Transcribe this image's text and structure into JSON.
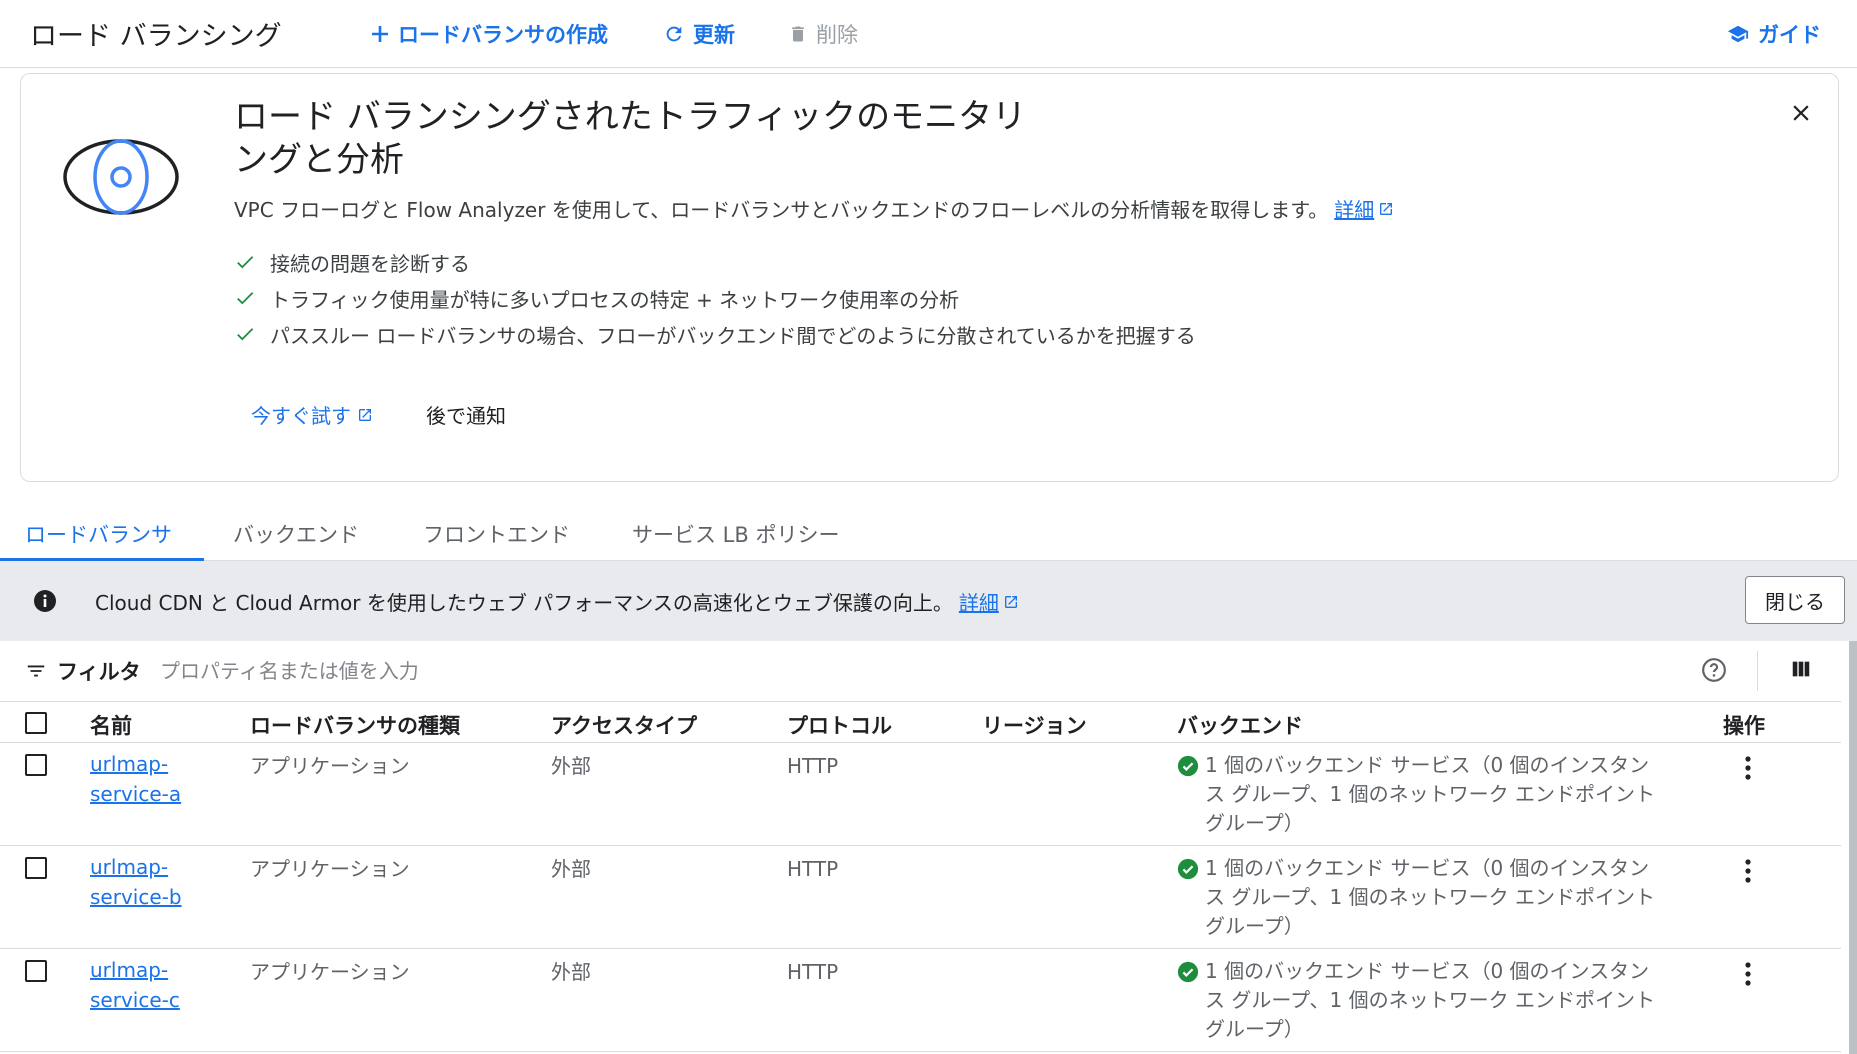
{
  "header": {
    "title": "ロード バランシング",
    "create_label": "ロードバランサの作成",
    "refresh_label": "更新",
    "delete_label": "削除",
    "guide_label": "ガイド"
  },
  "banner": {
    "title": "ロード バランシングされたトラフィックのモニタリングと分析",
    "description": "VPC フローログと Flow Analyzer を使用して、ロードバランサとバックエンドのフローレベルの分析情報を取得します。",
    "details_link": "詳細",
    "features": [
      "接続の問題を診断する",
      "トラフィック使用量が特に多いプロセスの特定 + ネットワーク使用率の分析",
      "パススルー ロードバランサの場合、フローがバックエンド間でどのように分散されているかを把握する"
    ],
    "try_now_label": "今すぐ試す",
    "remind_later_label": "後で通知"
  },
  "tabs": [
    {
      "label": "ロードバランサ",
      "active": true
    },
    {
      "label": "バックエンド",
      "active": false
    },
    {
      "label": "フロントエンド",
      "active": false
    },
    {
      "label": "サービス LB ポリシー",
      "active": false
    }
  ],
  "infobar": {
    "text": "Cloud CDN と Cloud Armor を使用したウェブ パフォーマンスの高速化とウェブ保護の向上。",
    "details_link": "詳細",
    "dismiss_label": "閉じる"
  },
  "filter": {
    "label": "フィルタ",
    "placeholder": "プロパティ名または値を入力"
  },
  "table": {
    "columns": [
      "名前",
      "ロードバランサの種類",
      "アクセスタイプ",
      "プロトコル",
      "リージョン",
      "バックエンド",
      "操作"
    ],
    "rows": [
      {
        "name": "urlmap-service-a",
        "type": "アプリケーション",
        "access": "外部",
        "protocol": "HTTP",
        "region": "",
        "backend": "1 個のバックエンド サービス（0 個のインスタンス グループ、1 個のネットワーク エンドポイント グループ）"
      },
      {
        "name": "urlmap-service-b",
        "type": "アプリケーション",
        "access": "外部",
        "protocol": "HTTP",
        "region": "",
        "backend": "1 個のバックエンド サービス（0 個のインスタンス グループ、1 個のネットワーク エンドポイント グループ）"
      },
      {
        "name": "urlmap-service-c",
        "type": "アプリケーション",
        "access": "外部",
        "protocol": "HTTP",
        "region": "",
        "backend": "1 個のバックエンド サービス（0 個のインスタンス グループ、1 個のネットワーク エンドポイント グループ）"
      }
    ]
  },
  "colors": {
    "accent": "#1a73e8",
    "success": "#1e8e3e",
    "infobar_bg": "#e8eaed",
    "border": "#dadce0"
  },
  "icons": {
    "create": "plus-icon",
    "refresh": "refresh-icon",
    "delete": "trash-icon",
    "guide": "graduation-cap-icon",
    "close": "close-icon",
    "info": "info-icon",
    "filter": "filter-icon",
    "help": "help-icon",
    "columns": "columns-icon",
    "more": "more-vert-icon",
    "check": "check-icon",
    "status": "check-circle-icon",
    "external": "open-in-new-icon"
  }
}
